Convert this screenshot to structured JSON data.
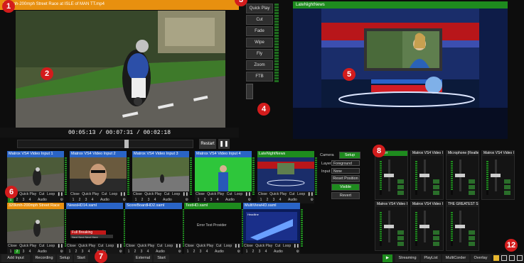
{
  "preview": {
    "title": "320kmh-200mph Street Race at ISLE of MAN TT.mp4",
    "timecode": "00:05:13 / 00:07:31 / 00:02:18",
    "restart_label": "Restart",
    "pause_icon": "pause-icon",
    "position_fraction": 0.63
  },
  "transitions": [
    "Quick Play",
    "Cut",
    "Fade",
    "Wipe",
    "Fly",
    "Zoom",
    "FTB"
  ],
  "program": {
    "title": "LateNightNews"
  },
  "inputs_row1": [
    {
      "title": "Matrox VS4 Video Input 1",
      "color": "#2a64c6",
      "scene": "moto",
      "numbers": [
        "1",
        "2",
        "3",
        "4"
      ],
      "active": "1"
    },
    {
      "title": "Matrox VS4 Video Input 2",
      "color": "#2a64c6",
      "scene": "face",
      "numbers": [
        "1",
        "2",
        "3",
        "4"
      ],
      "active": ""
    },
    {
      "title": "Matrox VS4 Video Input 3",
      "color": "#2a64c6",
      "scene": "track",
      "numbers": [
        "1",
        "2",
        "3",
        "4"
      ],
      "active": ""
    },
    {
      "title": "Matrox VS4 Video Input 4",
      "color": "#2a64c6",
      "scene": "green",
      "numbers": [
        "1",
        "2",
        "3",
        "4"
      ],
      "active": ""
    },
    {
      "title": "LateNightNews",
      "color": "#1e8b1e",
      "scene": "studio",
      "numbers": [
        "1",
        "2",
        "3",
        "4"
      ],
      "active": ""
    }
  ],
  "inputs_row2": [
    {
      "title": "320kmh-200mph Street Race",
      "color": "#e8900f",
      "scene": "moto2",
      "numbers": [
        "1",
        "2",
        "3",
        "4"
      ],
      "active": "2"
    },
    {
      "title": "NewsHD14.xaml",
      "color": "#2a64c6",
      "scene": "title1",
      "numbers": [
        "1",
        "2",
        "3",
        "4"
      ],
      "active": ""
    },
    {
      "title": "ScoreBoardHD2.xaml",
      "color": "#2a64c6",
      "scene": "title2",
      "numbers": [
        "1",
        "2",
        "3",
        "4"
      ],
      "active": ""
    },
    {
      "title": "TestHD.xaml",
      "color": "#1e8b1e",
      "scene": "text",
      "numbers": [
        "1",
        "2",
        "3",
        "4"
      ],
      "active": ""
    },
    {
      "title": "MultiViewHD.xaml",
      "color": "#2a64c6",
      "scene": "multi",
      "numbers": [
        "1",
        "2",
        "3",
        "4"
      ],
      "active": ""
    }
  ],
  "input_controls": {
    "close": "Close",
    "quick_play": "Quick Play",
    "cut": "Cut",
    "loop": "Loop",
    "audio": "Audio"
  },
  "title_text": {
    "title1_a": "Full Breaking",
    "title1_b": "Next Next Next Here",
    "text_sample": "Error Text Provider",
    "multi": "Headline"
  },
  "setup_panel": {
    "camera": "Camera",
    "setup": "Setup",
    "layer": "Layer",
    "layer_value": "Foreground",
    "input": "Input",
    "input_value": "None",
    "reset_position": "Reset Position",
    "visible": "Visible",
    "revert": "Revert"
  },
  "audio_strips": [
    {
      "name": "Master",
      "master": true
    },
    {
      "name": "Matrox VS4 Video In...",
      "master": false
    },
    {
      "name": "Microphone (Realtek...",
      "master": false
    },
    {
      "name": "Matrox VS4 Video In...",
      "master": false
    },
    {
      "name": "Matrox VS4 Video In...",
      "master": false
    },
    {
      "name": "Matrox VS4 Video In...",
      "master": false
    },
    {
      "name": "THE GREATEST S...",
      "master": false
    }
  ],
  "bottom": {
    "add_input": "Add Input",
    "recording": "Recording",
    "setup": "Setup",
    "start1": "Start",
    "external": "External",
    "start2": "Start",
    "streaming": "Streaming",
    "playlist": "PlayList",
    "multicorder": "MultiCorder",
    "overlay": "Overlay"
  },
  "callouts": [
    "1",
    "2",
    "3",
    "4",
    "5",
    "6",
    "7",
    "8",
    "12"
  ],
  "colors": {
    "accent_orange": "#e8900f",
    "accent_green": "#1e8b1e",
    "accent_blue": "#2a64c6",
    "callout_red": "#d31c1c"
  }
}
